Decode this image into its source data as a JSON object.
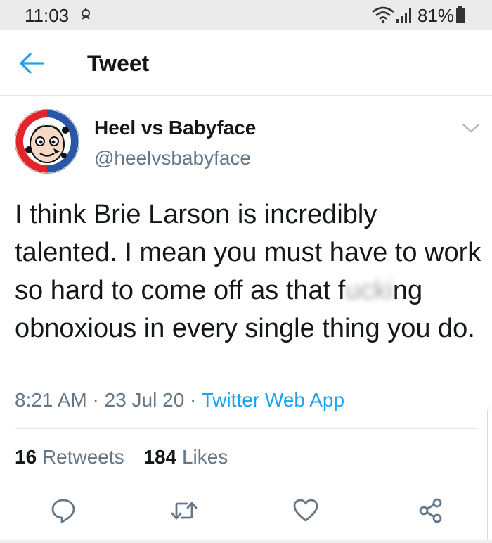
{
  "status_bar": {
    "time": "11:03",
    "battery": "81%"
  },
  "header": {
    "title": "Tweet"
  },
  "tweet": {
    "author": {
      "display_name": "Heel vs Babyface",
      "handle": "@heelvsbabyface"
    },
    "text": {
      "part1": "I think Brie Larson is incredibly talented. I mean you must have to work so hard to come off as that f",
      "censored": "ucki",
      "part2": "ng obnoxious in every single thing you do."
    },
    "meta": {
      "time": "8:21 AM",
      "separator": "·",
      "date": "23 Jul 20",
      "source": "Twitter Web App"
    },
    "stats": {
      "retweets_count": "16",
      "retweets_label": "Retweets",
      "likes_count": "184",
      "likes_label": "Likes"
    }
  },
  "icons": {
    "back": "arrow-left-icon",
    "caret": "chevron-down-icon",
    "reply": "reply-icon",
    "retweet": "retweet-icon",
    "like": "heart-icon",
    "share": "share-icon"
  },
  "colors": {
    "accent": "#1da1f2",
    "text": "#14171a",
    "muted": "#657786",
    "statusbar": "#ebebeb"
  }
}
